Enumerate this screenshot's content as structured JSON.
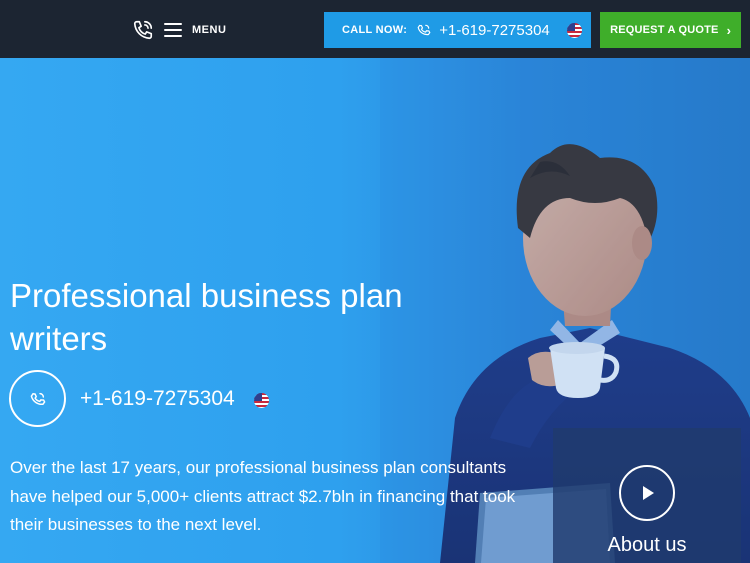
{
  "nav": {
    "menu_label": "MENU",
    "call": {
      "label": "CALL NOW:",
      "phone": "+1-619-7275304",
      "flag": "us-flag-icon"
    },
    "quote_label": "REQUEST A QUOTE",
    "quote_icon": "chevron-right-icon"
  },
  "hero": {
    "title": "Professional business plan writers",
    "phone": "+1-619-7275304",
    "description": "Over the last 17 years, our professional business plan consultants have helped our 5,000+ clients attract $2.7bln in financing that took their businesses to the next level.",
    "video_label": "About us"
  },
  "colors": {
    "topbar_bg": "#1c2532",
    "call_button": "#1f9be6",
    "quote_button": "#3fae2a",
    "hero_bg": "#2ea0ee"
  }
}
